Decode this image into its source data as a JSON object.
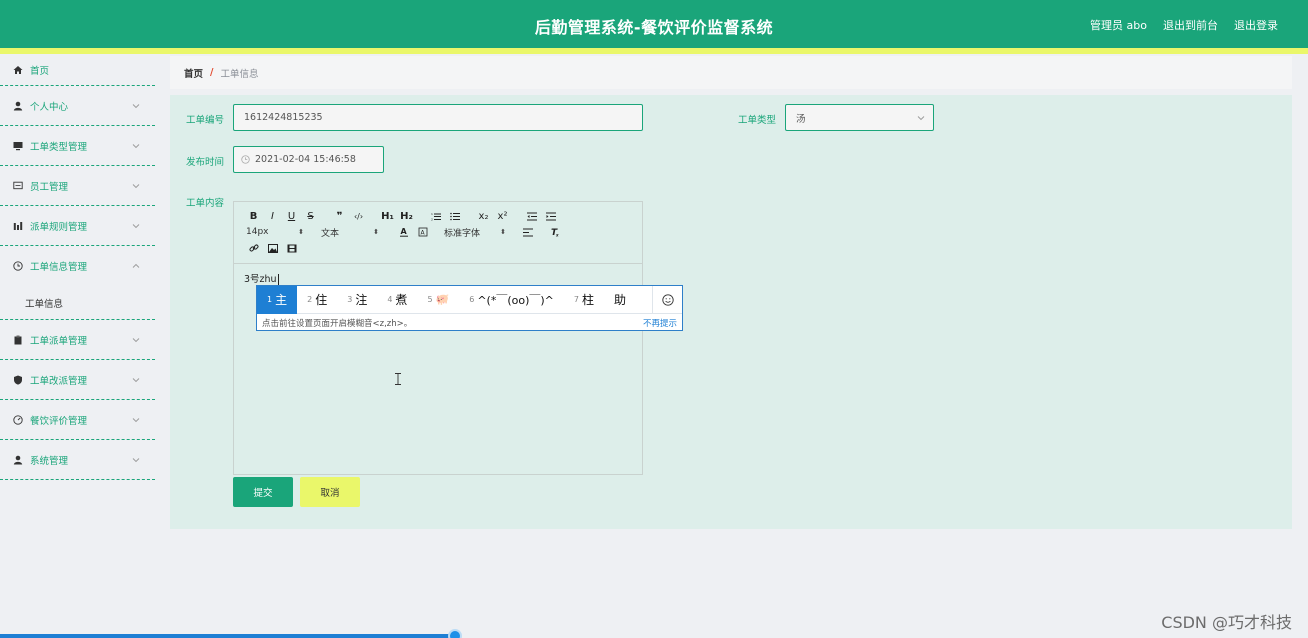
{
  "header": {
    "title": "后勤管理系统-餐饮评价监督系统",
    "links": [
      "管理员 abo",
      "退出到前台",
      "退出登录"
    ],
    "bg_color": "#1aa57a",
    "stripe_color": "#eaf76a"
  },
  "sidebar": {
    "items": [
      {
        "label": "首页",
        "icon": "home-icon"
      },
      {
        "label": "个人中心",
        "icon": "user-icon"
      },
      {
        "label": "工单类型管理",
        "icon": "monitor-icon"
      },
      {
        "label": "员工管理",
        "icon": "chat-icon"
      },
      {
        "label": "派单规则管理",
        "icon": "bar-chart-icon"
      },
      {
        "label": "工单信息管理",
        "icon": "clock-icon"
      },
      {
        "label": "工单派单管理",
        "icon": "clipboard-icon"
      },
      {
        "label": "工单改派管理",
        "icon": "shield-icon"
      },
      {
        "label": "餐饮评价管理",
        "icon": "gauge-icon"
      },
      {
        "label": "系统管理",
        "icon": "user-icon"
      }
    ],
    "sub_item": "工单信息"
  },
  "breadcrumb": {
    "home": "首页",
    "sep": "/",
    "current": "工单信息"
  },
  "form": {
    "order_no_label": "工单编号",
    "order_no_value": "1612424815235",
    "order_type_label": "工单类型",
    "order_type_value": "汤",
    "publish_time_label": "发布时间",
    "publish_time_value": "2021-02-04 15:46:58",
    "content_label": "工单内容",
    "content_value": "3号zhu"
  },
  "editor_toolbar": {
    "row1": [
      "B",
      "I",
      "U",
      "S",
      "❞",
      "‹/›",
      "H₁",
      "H₂",
      "ordered-list",
      "bullet-list",
      "x₂",
      "x²",
      "outdent",
      "indent"
    ],
    "font_size": "14px",
    "text_style": "文本",
    "font_family": "标准字体"
  },
  "ime": {
    "candidates": [
      {
        "num": "1",
        "text": "主"
      },
      {
        "num": "2",
        "text": "住"
      },
      {
        "num": "3",
        "text": "注"
      },
      {
        "num": "4",
        "text": "煮"
      },
      {
        "num": "5",
        "text": "🐖"
      },
      {
        "num": "6",
        "text": "^(*￣(oo)￣)^"
      },
      {
        "num": "7",
        "text": "柱"
      },
      {
        "num": "",
        "text": "助"
      }
    ],
    "hint": "点击前往设置页面开启模糊音<z,zh>。",
    "dismiss": "不再提示"
  },
  "buttons": {
    "submit": "提交",
    "cancel": "取消"
  },
  "watermark": "CSDN @巧才科技"
}
